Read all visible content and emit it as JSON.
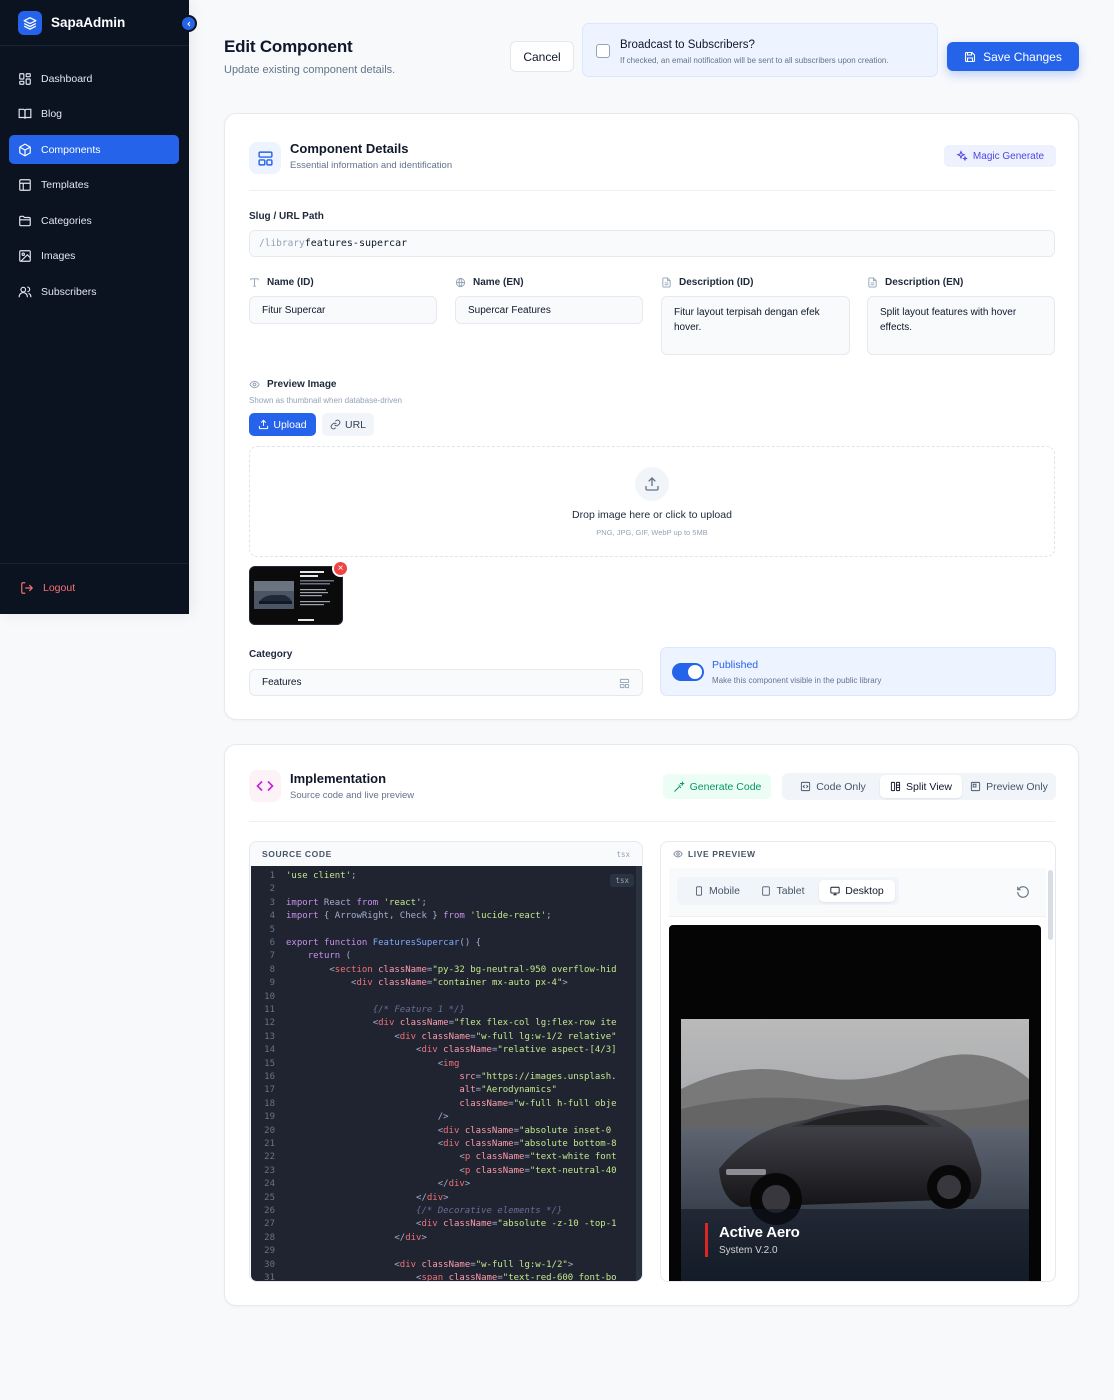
{
  "app": {
    "name": "SapaAdmin"
  },
  "sidebar": {
    "items": [
      {
        "label": "Dashboard",
        "icon": "dashboard-icon"
      },
      {
        "label": "Blog",
        "icon": "book-icon"
      },
      {
        "label": "Components",
        "icon": "cube-icon",
        "active": true
      },
      {
        "label": "Templates",
        "icon": "layout-icon"
      },
      {
        "label": "Categories",
        "icon": "folder-icon"
      },
      {
        "label": "Images",
        "icon": "image-icon"
      },
      {
        "label": "Subscribers",
        "icon": "users-icon"
      }
    ],
    "logout": "Logout"
  },
  "header": {
    "title": "Edit Component",
    "subtitle": "Update existing component details.",
    "cancel": "Cancel",
    "broadcast_title": "Broadcast to Subscribers?",
    "broadcast_sub": "If checked, an email notification will be sent to all subscribers upon creation.",
    "broadcast_checked": false,
    "save": "Save Changes"
  },
  "details": {
    "title": "Component Details",
    "subtitle": "Essential information and identification",
    "magic": "Magic Generate",
    "slug_label": "Slug / URL Path",
    "slug_prefix": "/library",
    "slug_value": "features-supercar",
    "name_id_label": "Name (ID)",
    "name_id_value": "Fitur Supercar",
    "name_en_label": "Name (EN)",
    "name_en_value": "Supercar Features",
    "desc_id_label": "Description (ID)",
    "desc_id_value": "Fitur layout terpisah dengan efek hover.",
    "desc_en_label": "Description (EN)",
    "desc_en_value": "Split layout features with hover effects.",
    "preview_label": "Preview Image",
    "preview_sub": "Shown as thumbnail when database-driven",
    "upload_tab": "Upload",
    "url_tab": "URL",
    "drop_text": "Drop image here or click to upload",
    "drop_sub": "PNG, JPG, GIF, WebP up to 5MB",
    "thumb_remove": "×",
    "category_label": "Category",
    "category_value": "Features",
    "published_title": "Published",
    "published_sub": "Make this component visible in the public library",
    "published_on": true
  },
  "implementation": {
    "title": "Implementation",
    "subtitle": "Source code and live preview",
    "generate": "Generate Code",
    "modes": [
      "Code Only",
      "Split View",
      "Preview Only"
    ],
    "active_mode": "Split View",
    "source_title": "SOURCE CODE",
    "source_lang": "tsx",
    "preview_title": "LIVE PREVIEW",
    "devices": [
      "Mobile",
      "Tablet",
      "Desktop"
    ],
    "active_device": "Desktop",
    "hero_title": "Active Aero",
    "hero_sub": "System V.2.0",
    "code_lines": [
      "'use client';",
      "",
      "import React from 'react';",
      "import { ArrowRight, Check } from 'lucide-react';",
      "",
      "export function FeaturesSupercar() {",
      "    return (",
      "        <section className=\"py-32 bg-neutral-950 overflow-hid",
      "            <div className=\"container mx-auto px-4\">",
      "",
      "                {/* Feature 1 */}",
      "                <div className=\"flex flex-col lg:flex-row ite",
      "                    <div className=\"w-full lg:w-1/2 relative\"",
      "                        <div className=\"relative aspect-[4/3]",
      "                            <img",
      "                                src=\"https://images.unsplash.",
      "                                alt=\"Aerodynamics\"",
      "                                className=\"w-full h-full obje",
      "                            />",
      "                            <div className=\"absolute inset-0",
      "                            <div className=\"absolute bottom-8",
      "                                <p className=\"text-white font",
      "                                <p className=\"text-neutral-40",
      "                            </div>",
      "                        </div>",
      "                        {/* Decorative elements */}",
      "                        <div className=\"absolute -z-10 -top-1",
      "                    </div>",
      "",
      "                    <div className=\"w-full lg:w-1/2\">",
      "                        <span className=\"text-red-600 font-bo"
    ]
  }
}
